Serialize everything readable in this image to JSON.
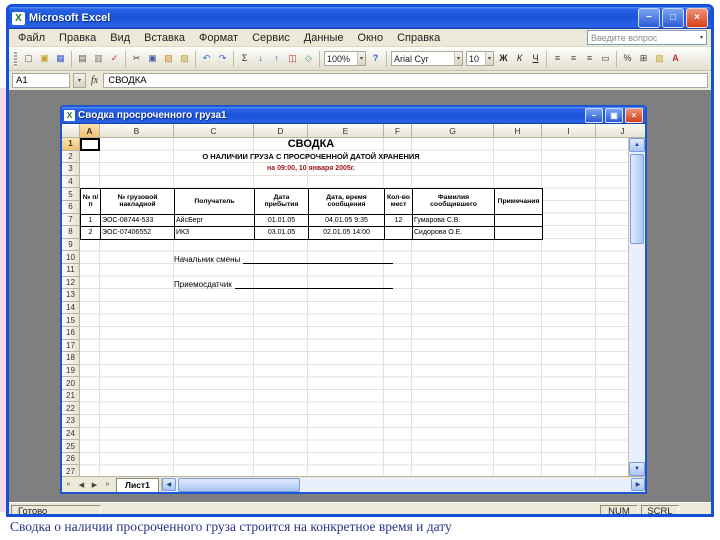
{
  "ui": {
    "excel_logo": "X",
    "dropdown_arrow": "▾",
    "up_arrow": "▲",
    "down_arrow": "▼",
    "left_arrow": "◀",
    "right_arrow": "▶",
    "tab_nav": [
      "«",
      "◀",
      "▶",
      "»"
    ],
    "window_buttons": {
      "minimize": "−",
      "maximize": "□",
      "restore": "▣",
      "close": "×"
    }
  },
  "colors": {
    "title_gradient": "#1c53d8",
    "mdi_background": "#7f7f7f",
    "date_line_text": "#9b1515",
    "caption_text": "#2c3387"
  },
  "titlebar": {
    "title": "Microsoft Excel"
  },
  "menubar": {
    "items": [
      "Файл",
      "Правка",
      "Вид",
      "Вставка",
      "Формат",
      "Сервис",
      "Данные",
      "Окно",
      "Справка"
    ],
    "question_placeholder": "Введите вопрос"
  },
  "toolbar": {
    "zoom_value": "100%",
    "help_glyph": "?",
    "font_name": "Arial Cyr",
    "font_size": "10",
    "std_icons": [
      {
        "name": "new-icon",
        "glyph": "▢",
        "color": "#555555"
      },
      {
        "name": "open-icon",
        "glyph": "▣",
        "color": "#c99a2e"
      },
      {
        "name": "save-icon",
        "glyph": "▦",
        "color": "#3a5fcd"
      },
      {
        "sep": true
      },
      {
        "name": "print-icon",
        "glyph": "▤",
        "color": "#555555"
      },
      {
        "name": "print-preview-icon",
        "glyph": "▥",
        "color": "#777777"
      },
      {
        "name": "spelling-icon",
        "glyph": "✓",
        "color": "#b03030"
      },
      {
        "sep": true
      },
      {
        "name": "cut-icon",
        "glyph": "✂",
        "color": "#444444"
      },
      {
        "name": "copy-icon",
        "glyph": "▣",
        "color": "#445a9a"
      },
      {
        "name": "paste-icon",
        "glyph": "▧",
        "color": "#c8862a"
      },
      {
        "name": "format-painter-icon",
        "glyph": "▨",
        "color": "#b8a030"
      },
      {
        "sep": true
      },
      {
        "name": "undo-icon",
        "glyph": "↶",
        "color": "#2f5fd0"
      },
      {
        "name": "redo-icon",
        "glyph": "↷",
        "color": "#2f5fd0"
      },
      {
        "sep": true
      },
      {
        "name": "autosum-icon",
        "glyph": "Σ",
        "color": "#333333"
      },
      {
        "name": "sort-ascending-icon",
        "glyph": "↓",
        "color": "#2f5fd0"
      },
      {
        "name": "sort-descending-icon",
        "glyph": "↑",
        "color": "#2f5fd0"
      },
      {
        "name": "chart-wizard-icon",
        "glyph": "◫",
        "color": "#b03030"
      },
      {
        "name": "drawing-icon",
        "glyph": "◇",
        "color": "#3a9a6a"
      },
      {
        "sep": true
      }
    ],
    "fmt_icons": [
      {
        "name": "bold-icon",
        "glyph": "Ж",
        "color": "#222222",
        "bold": true
      },
      {
        "name": "italic-icon",
        "glyph": "К",
        "color": "#222222",
        "italic": true
      },
      {
        "name": "underline-icon",
        "glyph": "Ч",
        "color": "#222222",
        "underline": true
      },
      {
        "sep": true
      },
      {
        "name": "align-left-icon",
        "glyph": "≡",
        "color": "#444444"
      },
      {
        "name": "align-center-icon",
        "glyph": "≡",
        "color": "#444444"
      },
      {
        "name": "align-right-icon",
        "glyph": "≡",
        "color": "#444444"
      },
      {
        "name": "merge-center-icon",
        "glyph": "▭",
        "color": "#444444"
      },
      {
        "sep": true
      },
      {
        "name": "percent-icon",
        "glyph": "%",
        "color": "#333333"
      },
      {
        "name": "borders-icon",
        "glyph": "⊞",
        "color": "#333333"
      },
      {
        "name": "fill-color-icon",
        "glyph": "▨",
        "color": "#c8a22a"
      },
      {
        "name": "font-color-icon",
        "glyph": "А",
        "color": "#c03030",
        "bold": true
      }
    ]
  },
  "formula_bar": {
    "name_box": "A1",
    "value": "СВОДКА"
  },
  "workbook": {
    "window_title": "Сводка просроченного груза1",
    "columns": [
      "A",
      "B",
      "C",
      "D",
      "E",
      "F",
      "G",
      "H",
      "I",
      "J"
    ],
    "row_numbers": [
      "1",
      "2",
      "3",
      "4",
      "5",
      "6",
      "7",
      "8",
      "9",
      "10",
      "11",
      "12",
      "13",
      "14",
      "15",
      "16",
      "17",
      "18",
      "19",
      "20",
      "21",
      "22",
      "23",
      "24",
      "25",
      "26",
      "27"
    ],
    "sheet_tab": "Лист1",
    "doc": {
      "title": "СВОДКА",
      "subtitle": "О НАЛИЧИИ ГРУЗА С ПРОСРОЧЕННОЙ ДАТОЙ ХРАНЕНИЯ",
      "date_line": "на 09:00, 10 января 2005г.",
      "table": {
        "headers": [
          "№ п/п",
          "№ грузовой накладной",
          "Получатель",
          "Дата прибытия",
          "Дата, время сообщения",
          "Кол-во мест",
          "Фамилия сообщившего",
          "Примечания"
        ],
        "rows": [
          [
            "1",
            "ЭОС-08744-533",
            "АйсБерг",
            "01.01.05",
            "04.01.05 9:35",
            "12",
            "Гумарова С.В.",
            ""
          ],
          [
            "2",
            "ЭОС-07406552",
            "ИКЗ",
            "03.01.05",
            "02.01.05 14:00",
            "",
            "Сидорова О.Е.",
            ""
          ]
        ]
      },
      "sign1": "Начальник смены",
      "sign2": "Приемосдатчик"
    }
  },
  "statusbar": {
    "left": "Готово",
    "num": "NUM",
    "scrl": "SCRL"
  },
  "caption": "Сводка о наличии просроченного груза строится на конкретное время и дату"
}
